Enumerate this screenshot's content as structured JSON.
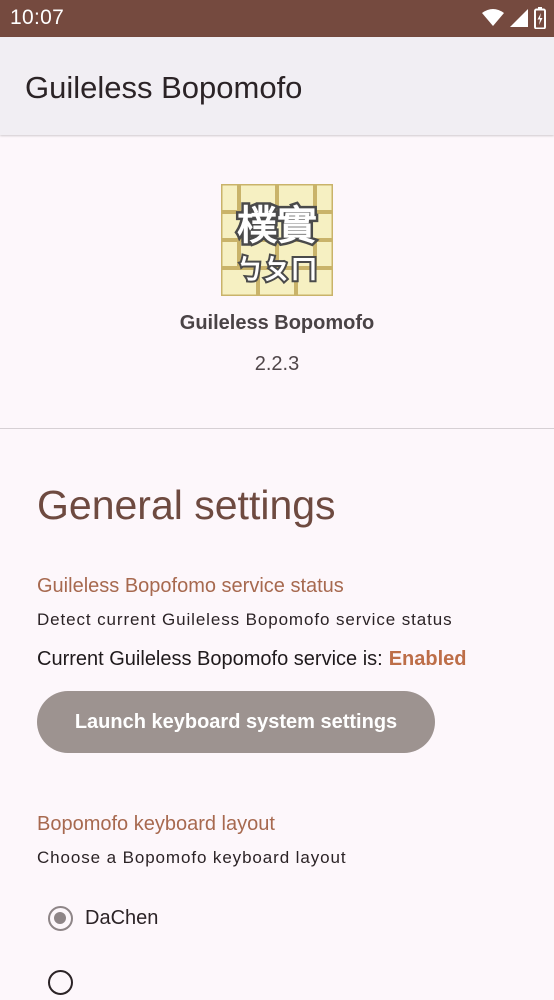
{
  "status_bar": {
    "time": "10:07",
    "icons": [
      "wifi-icon",
      "cellular-signal-icon",
      "battery-icon"
    ],
    "background": "#754a3f"
  },
  "app_bar": {
    "title": "Guileless Bopomofo"
  },
  "about": {
    "logo_chars_top": "樸實",
    "logo_chars_bottom": "ㄅㄆㄇ",
    "app_name": "Guileless Bopomofo",
    "version": "2.2.3"
  },
  "general": {
    "title": "General settings",
    "service": {
      "title": "Guileless Bopofomo service status",
      "summary": "Detect current Guileless Bopomofo service status",
      "status_prefix": "Current Guileless Bopomofo service is:",
      "status_value": "Enabled",
      "button_label": "Launch keyboard system settings"
    },
    "layout": {
      "title": "Bopomofo keyboard layout",
      "summary": "Choose a Bopomofo keyboard layout",
      "options": [
        {
          "label": "DaChen",
          "selected": true
        },
        {
          "label": "",
          "selected": false
        }
      ]
    }
  },
  "colors": {
    "accent_title": "#a7694f",
    "section_title": "#6e4a40",
    "enabled": "#bd6e48",
    "button": "#9d9390"
  }
}
